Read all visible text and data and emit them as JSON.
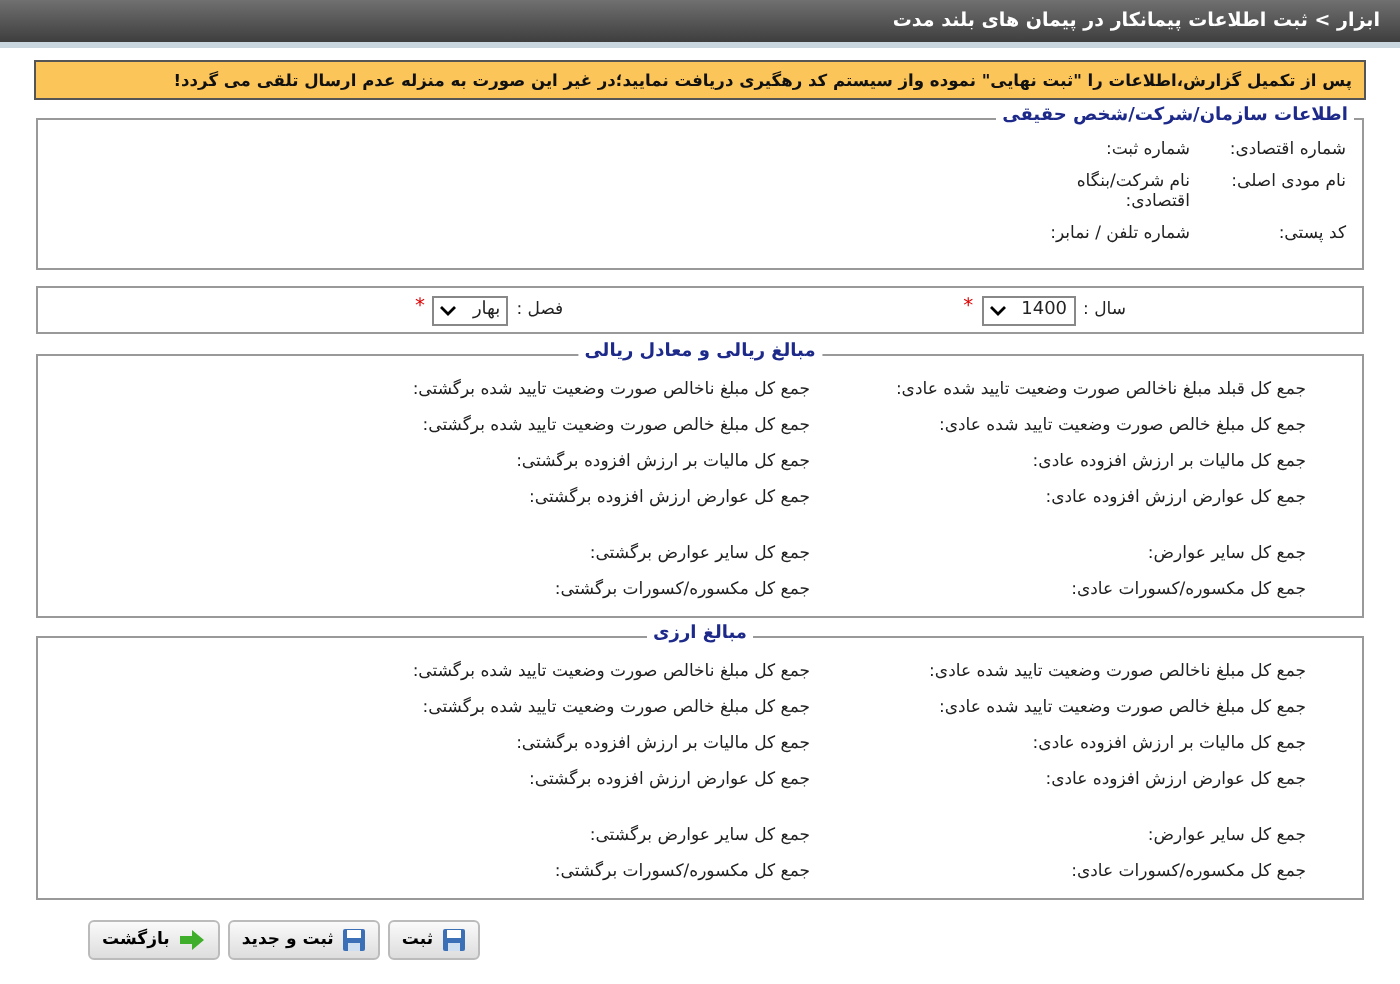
{
  "title": "ابزار > ثبت اطلاعات پیمانکار در پیمان های بلند مدت",
  "warning": "پس از تکمیل گزارش،اطلاعات را \"ثبت نهایی\" نموده واز سیستم کد رهگیری دریافت نمایید؛در غیر این صورت به منزله عدم ارسال تلقی می گردد!",
  "info": {
    "legend": "اطلاعات سازمان/شرکت/شخص حقیقی",
    "rows": [
      [
        "شماره اقتصادی:",
        "شماره ثبت:"
      ],
      [
        "نام مودی اصلی:",
        "نام شرکت/بنگاه اقتصادی:"
      ],
      [
        "کد پستی:",
        "شماره تلفن / نمابر:"
      ]
    ]
  },
  "period": [
    {
      "label": "سال :",
      "value": "1400",
      "required_mark": "*"
    },
    {
      "label": "فصل :",
      "value": "بهار",
      "required_mark": "*"
    }
  ],
  "sections": [
    {
      "legend": "مبالغ ریالی و معادل ریالی",
      "rows": [
        [
          "جمع کل قبلد مبلغ ناخالص صورت وضعیت تایید شده عادی:",
          "جمع کل مبلغ ناخالص صورت وضعیت تایید شده برگشتی:"
        ],
        [
          "جمع کل مبلغ خالص صورت وضعیت تایید شده عادی:",
          "جمع کل مبلغ خالص صورت وضعیت تایید شده برگشتی:"
        ],
        [
          "جمع کل مالیات بر ارزش افزوده عادی:",
          "جمع کل مالیات بر ارزش افزوده برگشتی:"
        ],
        [
          "جمع کل عوارض ارزش افزوده عادی:",
          "جمع کل عوارض ارزش افزوده برگشتی:"
        ],
        [
          "جمع کل سایر عوارض:",
          "جمع کل سایر عوارض برگشتی:"
        ],
        [
          "جمع کل مکسوره/کسورات عادی:",
          "جمع کل مکسوره/کسورات برگشتی:"
        ]
      ]
    },
    {
      "legend": "مبالغ ارزی",
      "rows": [
        [
          "جمع کل مبلغ ناخالص صورت وضعیت تایید شده عادی:",
          "جمع کل مبلغ ناخالص صورت وضعیت تایید شده برگشتی:"
        ],
        [
          "جمع کل مبلغ خالص صورت وضعیت تایید شده عادی:",
          "جمع کل مبلغ خالص صورت وضعیت تایید شده برگشتی:"
        ],
        [
          "جمع کل مالیات بر ارزش افزوده عادی:",
          "جمع کل مالیات بر ارزش افزوده برگشتی:"
        ],
        [
          "جمع کل عوارض ارزش افزوده عادی:",
          "جمع کل عوارض ارزش افزوده برگشتی:"
        ],
        [
          "جمع کل سایر عوارض:",
          "جمع کل سایر عوارض برگشتی:"
        ],
        [
          "جمع کل مکسوره/کسورات عادی:",
          "جمع کل مکسوره/کسورات برگشتی:"
        ]
      ]
    }
  ],
  "buttons": [
    {
      "label": "ثبت",
      "kind": "save"
    },
    {
      "label": "ثبت و جدید",
      "kind": "save"
    },
    {
      "label": "بازگشت",
      "kind": "back"
    }
  ]
}
